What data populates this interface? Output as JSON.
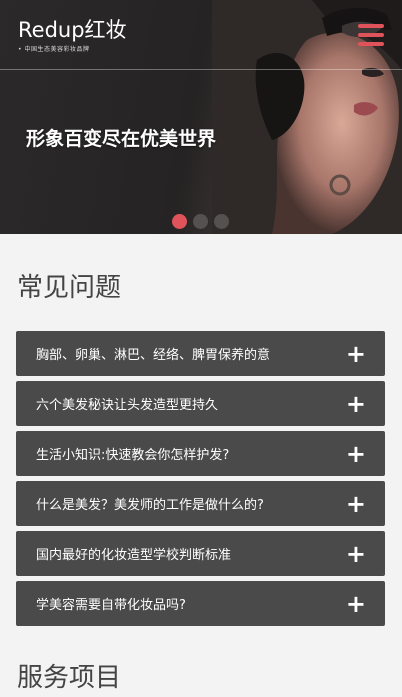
{
  "header": {
    "logo_text": "Redup红妆",
    "logo_tagline": "• 中国生态美容彩妆品牌",
    "menu_icon": "hamburger-menu-icon"
  },
  "hero": {
    "slogan": "形象百变尽在优美世界",
    "slide_count": 3,
    "active_slide": 1
  },
  "faq": {
    "title": "常见问题",
    "items": [
      {
        "question": "胸部、卵巢、淋巴、经络、脾胃保养的意",
        "icon": "plus-icon",
        "symbol": "+"
      },
      {
        "question": "六个美发秘诀让头发造型更持久",
        "icon": "plus-icon",
        "symbol": "+"
      },
      {
        "question": "生活小知识:快速教会你怎样护发?",
        "icon": "plus-icon",
        "symbol": "+"
      },
      {
        "question": "什么是美发？美发师的工作是做什么的?",
        "icon": "plus-icon",
        "symbol": "+"
      },
      {
        "question": "国内最好的化妆造型学校判断标准",
        "icon": "plus-icon",
        "symbol": "+"
      },
      {
        "question": "学美容需要自带化妆品吗?",
        "icon": "plus-icon",
        "symbol": "+"
      }
    ]
  },
  "services": {
    "title": "服务项目"
  },
  "colors": {
    "accent": "#e0535a",
    "faq_bg": "#4a4a4a",
    "page_bg": "#f3f3f3",
    "hero_bg": "#2b2929"
  }
}
